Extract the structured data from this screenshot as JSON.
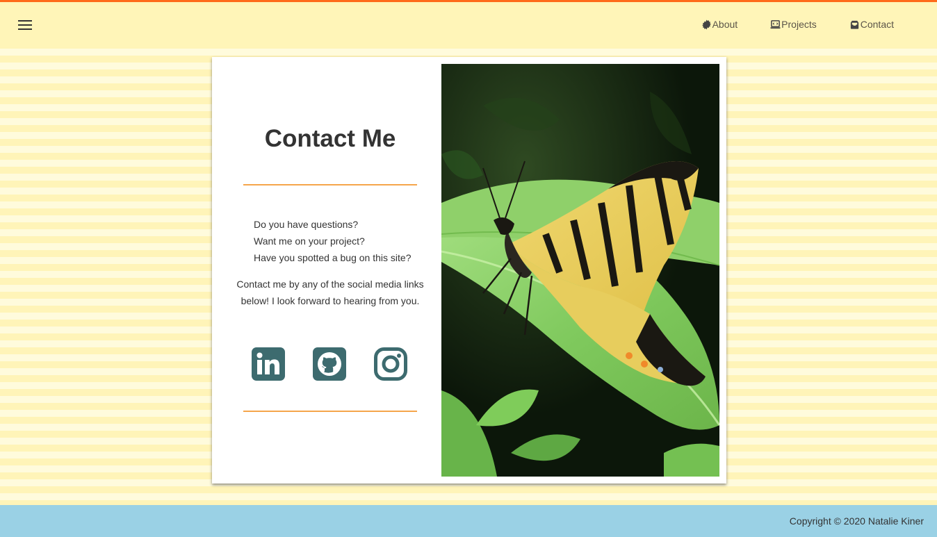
{
  "header": {
    "menu_icon": "hamburger-menu-icon",
    "nav": [
      {
        "label": "About",
        "icon": "gear-badge-icon"
      },
      {
        "label": "Projects",
        "icon": "laptop-icon"
      },
      {
        "label": "Contact",
        "icon": "inbox-icon"
      }
    ]
  },
  "contact": {
    "title": "Contact Me",
    "questions": [
      "Do you have questions?",
      "Want me on your project?",
      "Have you spotted a bug on this site?"
    ],
    "invite": "Contact me by any of the social media links below! I look forward to hearing from you.",
    "socials": [
      {
        "icon": "linkedin-icon"
      },
      {
        "icon": "github-icon"
      },
      {
        "icon": "instagram-icon"
      }
    ],
    "photo_icon": "butterfly-photo"
  },
  "footer": {
    "copyright": "Copyright © 2020 Natalie Kiner"
  },
  "colors": {
    "accent_orange": "#ff6a1a",
    "divider": "#f5a54a",
    "social_teal": "#3d6b6f",
    "header_bg": "#fff5b8",
    "footer_bg": "#9ad1e5"
  }
}
